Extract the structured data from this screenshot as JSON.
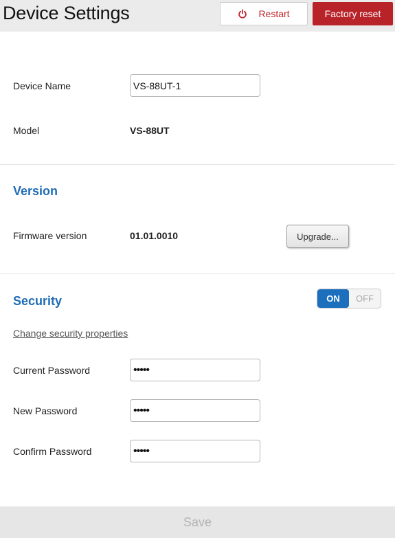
{
  "header": {
    "title": "Device Settings",
    "restart_label": "Restart",
    "factory_reset_label": "Factory reset",
    "restart_icon": "power-icon",
    "accent_color": "#b8232a"
  },
  "general": {
    "device_name_label": "Device Name",
    "device_name_value": "VS-88UT-1",
    "model_label": "Model",
    "model_value": "VS-88UT"
  },
  "version": {
    "title": "Version",
    "firmware_label": "Firmware version",
    "firmware_value": "01.01.0010",
    "upgrade_label": "Upgrade..."
  },
  "security": {
    "title": "Security",
    "toggle_on_label": "ON",
    "toggle_off_label": "OFF",
    "toggle_state": "on",
    "change_link": "Change security properties",
    "current_password_label": "Current Password",
    "current_password_value": "•••••",
    "new_password_label": "New Password",
    "new_password_value": "•••••",
    "confirm_password_label": "Confirm Password",
    "confirm_password_value": "•••••"
  },
  "footer": {
    "save_label": "Save"
  }
}
